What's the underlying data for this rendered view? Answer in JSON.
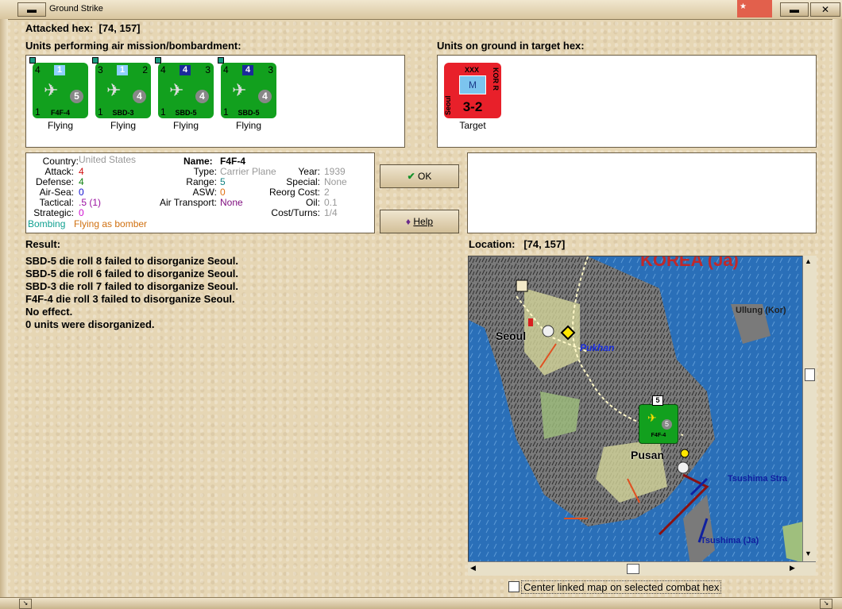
{
  "window": {
    "title": "Ground Strike"
  },
  "attacked_hex": {
    "label": "Attacked hex:",
    "value": "[74, 157]"
  },
  "air_units": {
    "header": "Units performing air mission/bombardment:",
    "units": [
      {
        "atk": "4",
        "type_num": "1",
        "name": "F4F-4",
        "num_right": "",
        "def_circle": "5",
        "bottom_left": "1",
        "status": "Flying"
      },
      {
        "atk": "3",
        "type_num": "1",
        "name": "SBD-3",
        "num_right": "2",
        "def_circle": "4",
        "bottom_left": "1",
        "status": "Flying"
      },
      {
        "atk": "4",
        "type_num": "4",
        "name": "SBD-5",
        "num_right": "3",
        "def_circle": "4",
        "bottom_left": "1",
        "status": "Flying"
      },
      {
        "atk": "4",
        "type_num": "4",
        "name": "SBD-5",
        "num_right": "3",
        "def_circle": "4",
        "bottom_left": "1",
        "status": "Flying"
      }
    ]
  },
  "ground_units": {
    "header": "Units on ground in target hex:",
    "target": {
      "size": "XXX",
      "side_left": "Seoul",
      "side_right": "KOR R",
      "symbol": "M",
      "strength": "3-2",
      "status": "Target"
    }
  },
  "info": {
    "country_label": "Country:",
    "country": "United States",
    "attack_label": "Attack:",
    "attack": "4",
    "defense_label": "Defense:",
    "defense": "4",
    "airsea_label": "Air-Sea:",
    "airsea": "0",
    "tactical_label": "Tactical:",
    "tactical": ".5 (1)",
    "strategic_label": "Strategic:",
    "strategic": "0",
    "bombing": "Bombing",
    "flying": "Flying as bomber",
    "name_label": "Name:",
    "name": "F4F-4",
    "type_label": "Type:",
    "type": "Carrier Plane",
    "range_label": "Range:",
    "range": "5",
    "asw_label": "ASW:",
    "asw": "0",
    "airtransport_label": "Air Transport:",
    "airtransport": "None",
    "year_label": "Year:",
    "year": "1939",
    "special_label": "Special:",
    "special": "None",
    "reorg_label": "Reorg Cost:",
    "reorg": "2",
    "oil_label": "Oil:",
    "oil": "0.1",
    "cost_label": "Cost/Turns:",
    "cost": "1/4"
  },
  "buttons": {
    "ok": "OK",
    "help": "Help"
  },
  "result": {
    "label": "Result:",
    "lines": [
      "SBD-5 die roll 8 failed to disorganize Seoul.",
      "SBD-5 die roll 6 failed to disorganize Seoul.",
      "SBD-3 die roll 7 failed to disorganize Seoul.",
      "F4F-4 die roll 3 failed to disorganize Seoul.",
      "No effect.",
      "0 units were disorganized."
    ]
  },
  "location": {
    "label": "Location:",
    "value": "[74, 157]"
  },
  "map": {
    "title": "KOREA (Ja)",
    "labels": {
      "seoul": "Seoul",
      "pukhan": "Pukhan",
      "pusan": "Pusan",
      "ullung": "Ullung (Kor)",
      "tsushima_strait": "Tsushima Stra",
      "tsushima": "Tsushima (Ja)"
    },
    "unit": {
      "name": "F4F-4",
      "circle": "5",
      "stack": "5"
    }
  },
  "center_checkbox": {
    "label": "Center linked map on selected combat hex",
    "checked": false
  },
  "colors": {
    "unit_green": "#12a01e",
    "enemy_red": "#e8202a",
    "sea": "#1f5fa6",
    "land": "#6e6e6e"
  }
}
